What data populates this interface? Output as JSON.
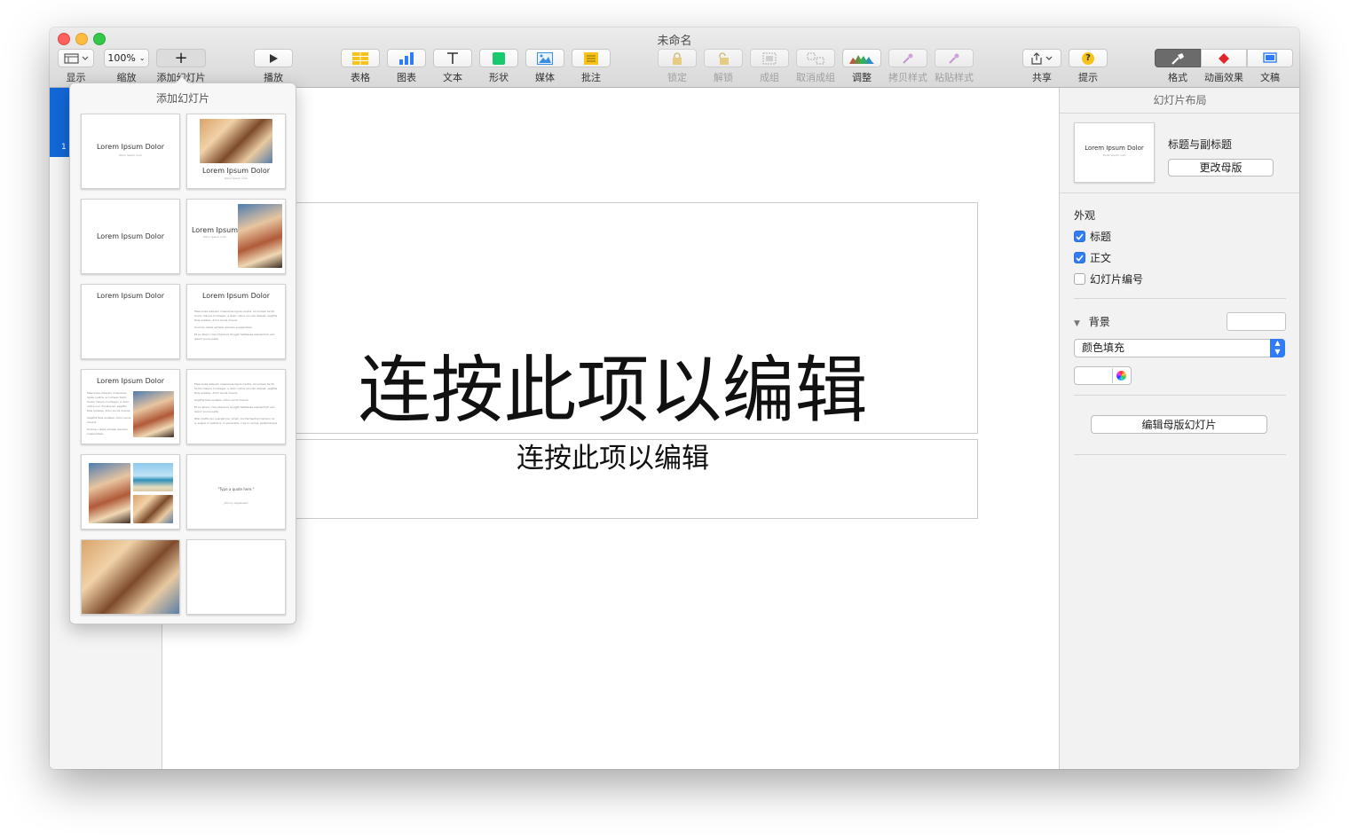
{
  "window": {
    "title": "未命名"
  },
  "toolbar": {
    "view": {
      "label": "显示"
    },
    "zoom": {
      "label": "缩放",
      "value": "100%"
    },
    "add_slide": {
      "label": "添加幻灯片"
    },
    "play": {
      "label": "播放"
    },
    "table": {
      "label": "表格"
    },
    "chart": {
      "label": "图表"
    },
    "text": {
      "label": "文本"
    },
    "shape": {
      "label": "形状"
    },
    "media": {
      "label": "媒体"
    },
    "comment": {
      "label": "批注"
    },
    "lock": {
      "label": "锁定"
    },
    "unlock": {
      "label": "解锁"
    },
    "group": {
      "label": "成组"
    },
    "ungroup": {
      "label": "取消成组"
    },
    "adjust": {
      "label": "调整"
    },
    "copy_style": {
      "label": "拷贝样式"
    },
    "paste_style": {
      "label": "粘贴样式"
    },
    "share": {
      "label": "共享"
    },
    "tips": {
      "label": "提示"
    },
    "format": {
      "label": "格式"
    },
    "animate": {
      "label": "动画效果"
    },
    "document": {
      "label": "文稿"
    }
  },
  "navigator": {
    "slide_number": "1"
  },
  "canvas": {
    "title_text": "连按此项以编辑",
    "subtitle_text": "连按此项以编辑"
  },
  "popover": {
    "title": "添加幻灯片",
    "sample_title": "Lorem Ipsum Dolor",
    "sample_title_short": "Lorem Ipsum",
    "sample_subtitle": "Dolor ipsum num",
    "quote_text": "\"Type a quote here.\"",
    "quote_attribution": "Johnny Appleseed",
    "bullets": [
      "Maecenas aliquam maecenas ligula nostra, accumsan taciti. Sociis mauris in integer, a dolor netus non dui aliquet, sagittis felis sodales, dolor sociis mauris",
      "Sagittis felis sodales, dolor sociis mauris",
      "Socioqu netus semper aenean suspendisse",
      "Et eu libero cras interdum at eget habitasse elementum est, ipsum purus pede",
      "Wisi mattis leo suscipit nec amet, nisl fermentum tempor ac a, augue in eleifend, in venenatis, cras in varius, pellentesque"
    ]
  },
  "inspector": {
    "header": "幻灯片布局",
    "layout_thumb_title": "Lorem Ipsum Dolor",
    "layout_thumb_subtitle": "Dolor ipsum num",
    "layout_name": "标题与副标题",
    "change_master": "更改母版",
    "appearance_label": "外观",
    "checkboxes": [
      {
        "label": "标题",
        "checked": true
      },
      {
        "label": "正文",
        "checked": true
      },
      {
        "label": "幻灯片编号",
        "checked": false
      }
    ],
    "background_label": "背景",
    "fill_select": "颜色填充",
    "edit_master": "编辑母版幻灯片"
  },
  "colors": {
    "accent": "#2f7cf6",
    "selection": "#1268d8"
  }
}
